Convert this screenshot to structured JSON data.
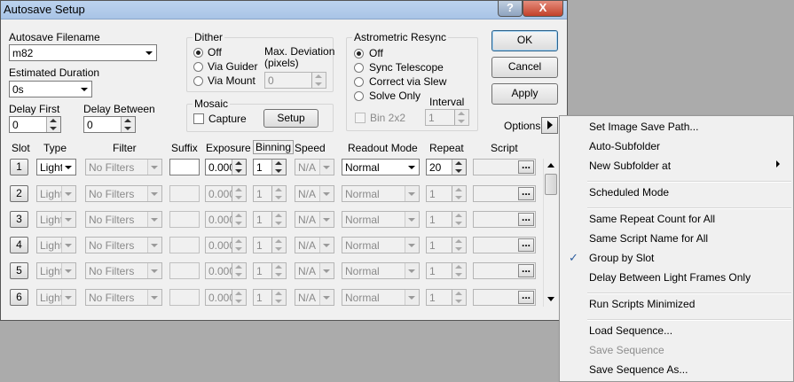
{
  "window": {
    "title": "Autosave Setup",
    "help_label": "?",
    "close_label": "X"
  },
  "fields": {
    "filename_label": "Autosave Filename",
    "filename_value": "m82",
    "duration_label": "Estimated Duration",
    "duration_value": "0s",
    "delay_first_label": "Delay First",
    "delay_first_value": "0",
    "delay_between_label": "Delay Between",
    "delay_between_value": "0"
  },
  "dither": {
    "legend": "Dither",
    "options": [
      "Off",
      "Via Guider",
      "Via Mount"
    ],
    "selected": "Off",
    "max_dev_label_1": "Max. Deviation",
    "max_dev_label_2": "(pixels)",
    "max_dev_value": "0"
  },
  "mosaic": {
    "legend": "Mosaic",
    "capture_label": "Capture",
    "setup_label": "Setup"
  },
  "astrometric": {
    "legend": "Astrometric Resync",
    "options": [
      "Off",
      "Sync Telescope",
      "Correct via Slew",
      "Solve Only"
    ],
    "selected": "Off",
    "bin_label": "Bin 2x2",
    "interval_label": "Interval",
    "interval_value": "1"
  },
  "buttons": {
    "ok": "OK",
    "cancel": "Cancel",
    "apply": "Apply",
    "options": "Options"
  },
  "table": {
    "headers": {
      "slot": "Slot",
      "type": "Type",
      "filter": "Filter",
      "suffix": "Suffix",
      "exposure": "Exposure",
      "binning": "Binning",
      "speed": "Speed",
      "readout": "Readout Mode",
      "repeat": "Repeat",
      "script": "Script"
    },
    "rows": [
      {
        "slot": "1",
        "type": "Light",
        "filter": "No Filters",
        "exposure": "0.000",
        "binning": "1",
        "speed": "N/A",
        "readout": "Normal",
        "repeat": "20",
        "script_btn": "...",
        "enabled": true
      },
      {
        "slot": "2",
        "type": "Light",
        "filter": "No Filters",
        "exposure": "0.000",
        "binning": "1",
        "speed": "N/A",
        "readout": "Normal",
        "repeat": "1",
        "script_btn": "...",
        "enabled": false
      },
      {
        "slot": "3",
        "type": "Light",
        "filter": "No Filters",
        "exposure": "0.000",
        "binning": "1",
        "speed": "N/A",
        "readout": "Normal",
        "repeat": "1",
        "script_btn": "...",
        "enabled": false
      },
      {
        "slot": "4",
        "type": "Light",
        "filter": "No Filters",
        "exposure": "0.000",
        "binning": "1",
        "speed": "N/A",
        "readout": "Normal",
        "repeat": "1",
        "script_btn": "...",
        "enabled": false
      },
      {
        "slot": "5",
        "type": "Light",
        "filter": "No Filters",
        "exposure": "0.000",
        "binning": "1",
        "speed": "N/A",
        "readout": "Normal",
        "repeat": "1",
        "script_btn": "...",
        "enabled": false
      },
      {
        "slot": "6",
        "type": "Light",
        "filter": "No Filters",
        "exposure": "0.000",
        "binning": "1",
        "speed": "N/A",
        "readout": "Normal",
        "repeat": "1",
        "script_btn": "...",
        "enabled": false
      }
    ]
  },
  "menu": {
    "items": [
      {
        "label": "Set Image Save Path...",
        "enabled": true,
        "checked": false,
        "submenu": false
      },
      {
        "label": "Auto-Subfolder",
        "enabled": true,
        "checked": false,
        "submenu": false
      },
      {
        "label": "New Subfolder at",
        "enabled": true,
        "checked": false,
        "submenu": true
      },
      {
        "label": "Scheduled Mode",
        "enabled": true,
        "checked": false,
        "submenu": false
      },
      {
        "label": "Same Repeat Count for All",
        "enabled": true,
        "checked": false,
        "submenu": false
      },
      {
        "label": "Same Script Name for All",
        "enabled": true,
        "checked": false,
        "submenu": false
      },
      {
        "label": "Group by Slot",
        "enabled": true,
        "checked": true,
        "submenu": false
      },
      {
        "label": "Delay Between Light Frames Only",
        "enabled": true,
        "checked": false,
        "submenu": false
      },
      {
        "label": "Run Scripts Minimized",
        "enabled": true,
        "checked": false,
        "submenu": false
      },
      {
        "label": "Load Sequence...",
        "enabled": true,
        "checked": false,
        "submenu": false
      },
      {
        "label": "Save Sequence",
        "enabled": false,
        "checked": false,
        "submenu": false
      },
      {
        "label": "Save Sequence As...",
        "enabled": true,
        "checked": false,
        "submenu": false
      }
    ],
    "check_glyph": "✓"
  },
  "colors": {
    "titlebar": "#bcd3ee",
    "close": "#c2412a",
    "dialog": "#f0f0f0",
    "backdrop": "#ababab"
  }
}
